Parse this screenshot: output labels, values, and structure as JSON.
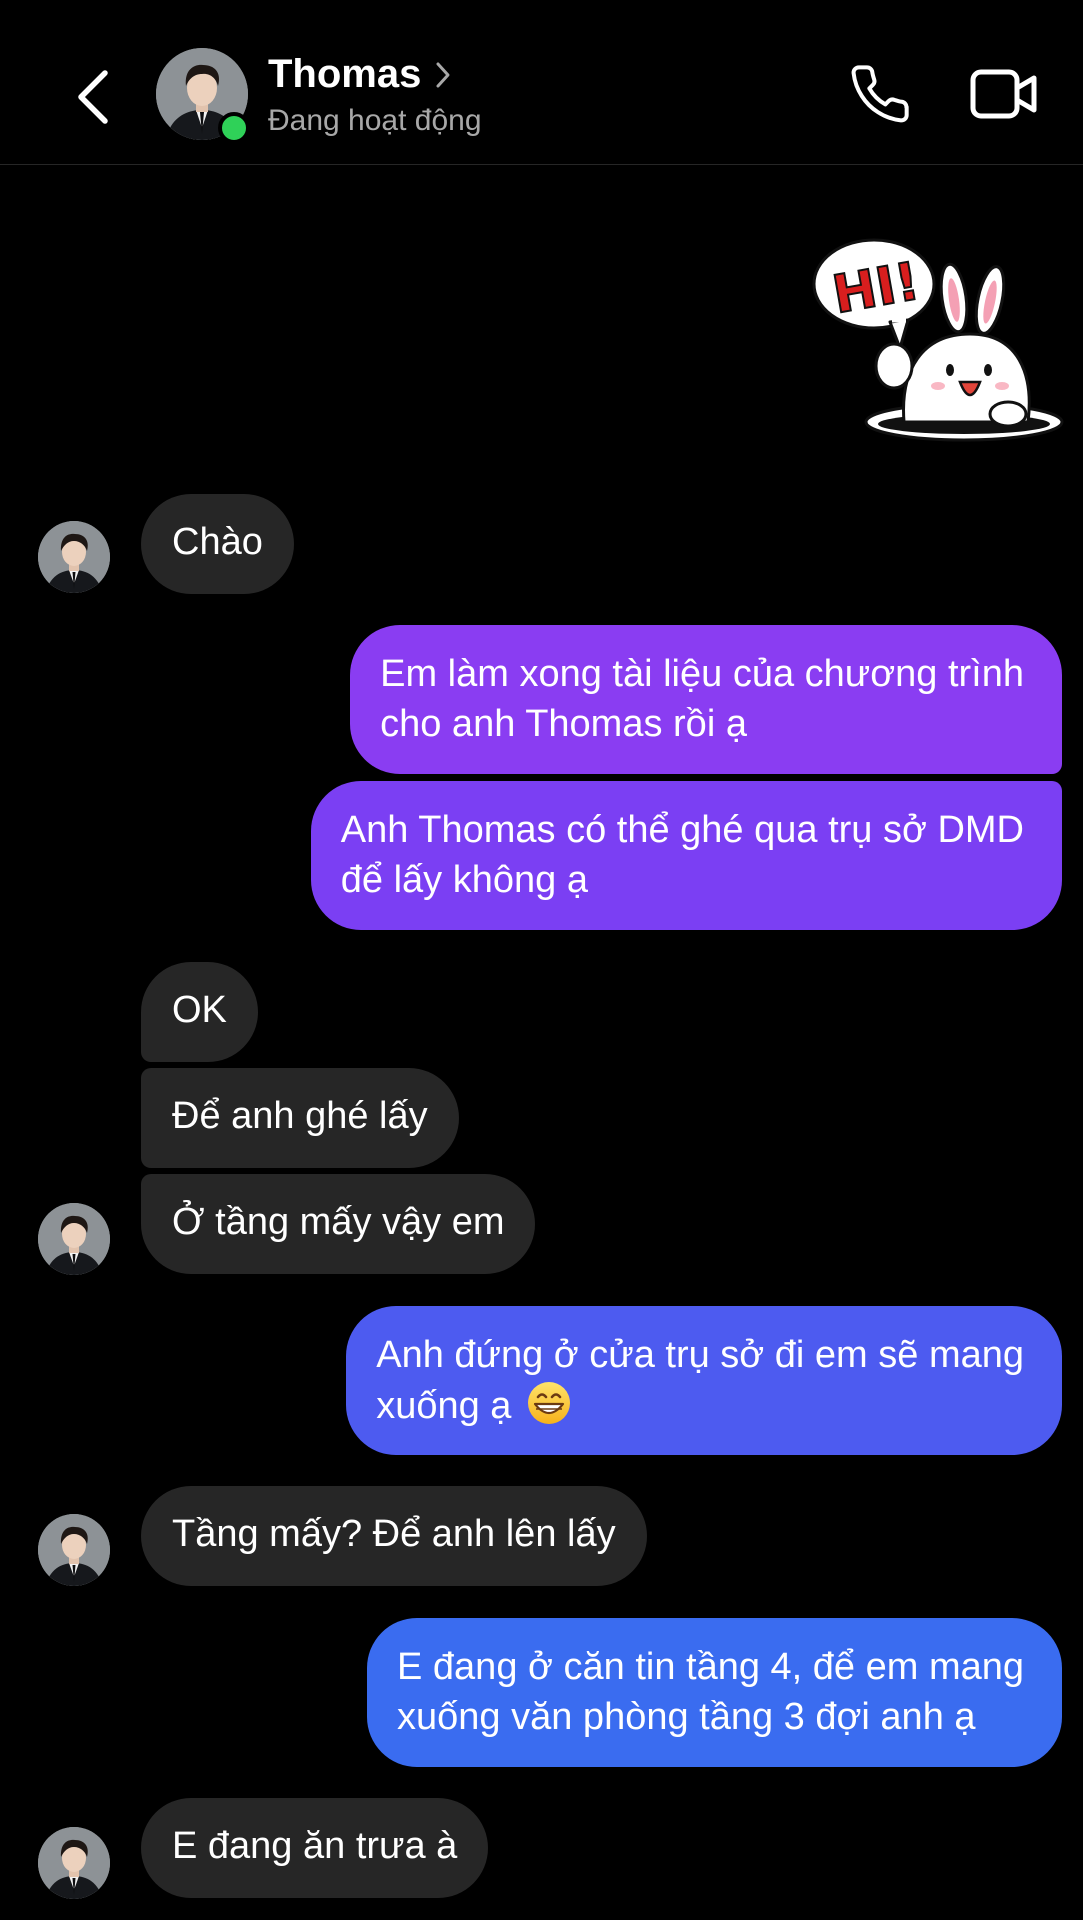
{
  "header": {
    "contact_name": "Thomas",
    "status": "Đang hoạt động",
    "icons": {
      "back": "chevron-left-icon",
      "name_chevron": "chevron-right-icon",
      "call": "phone-icon",
      "video": "video-camera-icon"
    },
    "colors": {
      "online": "#2fd158"
    }
  },
  "sticker": {
    "text": "HI!"
  },
  "messages": [
    {
      "from": "them",
      "text": "Chào"
    },
    {
      "from": "me",
      "lines": [
        "Em làm xong tài liệu của chương trình",
        "cho anh Thomas rồi ạ"
      ]
    },
    {
      "from": "me",
      "lines": [
        "Anh Thomas có thể ghé qua trụ sở DMD",
        "để lấy không ạ"
      ]
    },
    {
      "from": "them",
      "text": "OK"
    },
    {
      "from": "them",
      "text": "Để anh ghé lấy"
    },
    {
      "from": "them",
      "text": "Ở tầng mấy vậy em"
    },
    {
      "from": "me",
      "lines": [
        "Anh đứng ở cửa trụ sở đi em sẽ mang",
        "xuống ạ"
      ],
      "emoji": "😁"
    },
    {
      "from": "them",
      "text": "Tầng mấy? Để anh lên lấy"
    },
    {
      "from": "me",
      "lines": [
        "E đang ở căn tin tầng 4, để em mang",
        "xuống văn phòng tầng 3 đợi anh ạ"
      ]
    },
    {
      "from": "them",
      "text": "E đang ăn trưa à"
    }
  ],
  "colors": {
    "background": "#000000",
    "incoming_bubble": "#262626",
    "outgoing_gradient": [
      "#8a3df2",
      "#7b3ff3",
      "#4d5bf0",
      "#3a6cf0"
    ]
  }
}
